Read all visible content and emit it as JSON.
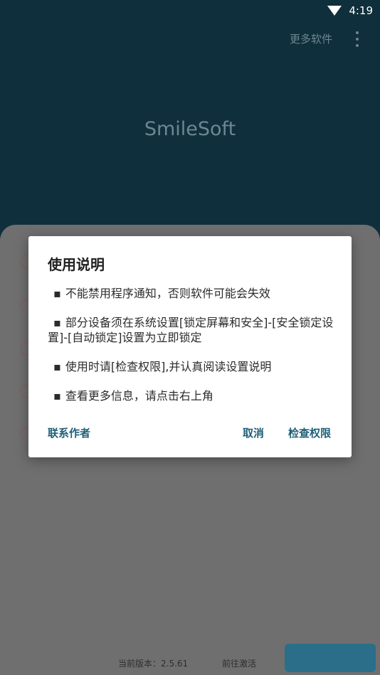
{
  "status_bar": {
    "time": "4:19",
    "wifi_icon": "wifi-icon"
  },
  "toolbar": {
    "more_software": "更多软件",
    "overflow_icon": "more-vert-icon"
  },
  "app": {
    "title": "SmileSoft"
  },
  "footer": {
    "version": "当前版本：2.5.61",
    "activate": "前往激活"
  },
  "dialog": {
    "title": "使用说明",
    "items": [
      "不能禁用程序通知，否则软件可能会失效",
      "部分设备须在系统设置[锁定屏幕和安全]-[安全锁定设置]-[自动锁定]设置为立即锁定",
      "使用时请[检查权限],并认真阅读设置说明",
      "查看更多信息，请点击右上角"
    ],
    "actions": {
      "contact": "联系作者",
      "cancel": "取消",
      "check": "检查权限"
    }
  },
  "colors": {
    "header_bg": "#0f2f3c",
    "accent": "#1f5f78",
    "overlay": "#6b6b6b"
  }
}
